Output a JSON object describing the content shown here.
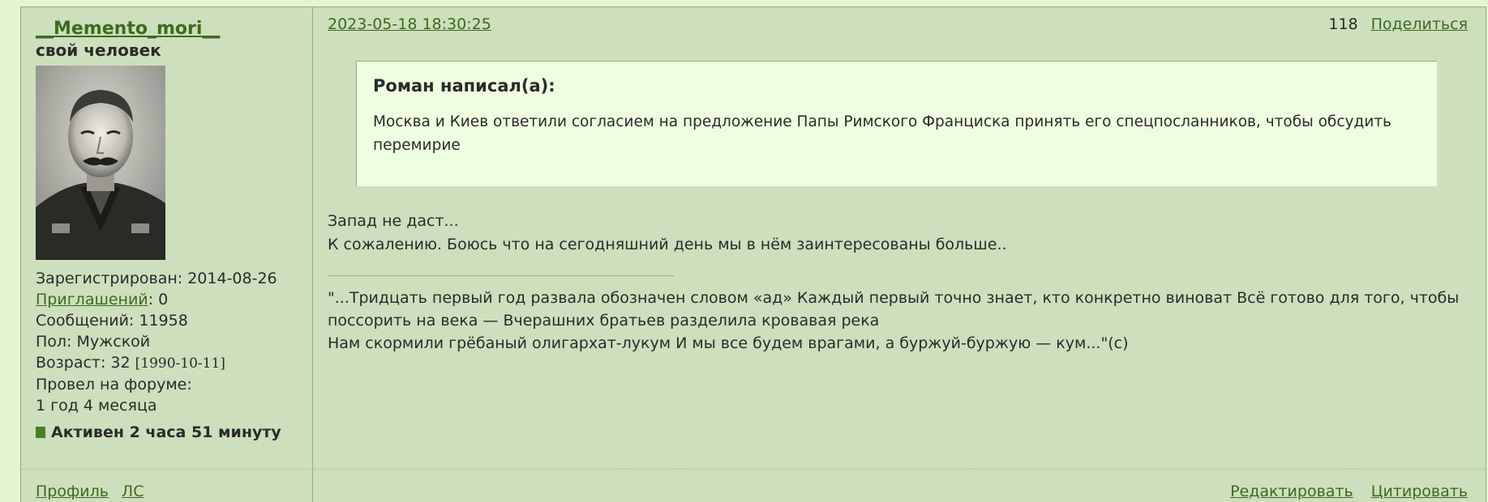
{
  "user": {
    "name": "__Memento_mori__",
    "title": "свой человек",
    "registered": "Зарегистрирован: 2014-08-26",
    "invites_label": "Приглашений",
    "invites_value": ": 0",
    "messages": "Сообщений: 11958",
    "gender": "Пол: Мужской",
    "age": "Возраст: 32 ",
    "birthdate": "[1990-10-11]",
    "forum_time_label": "Провел на форуме:",
    "forum_time_value": "1 год 4 месяца",
    "active": "Активен 2 часа 51 минуту"
  },
  "post": {
    "date": "2023-05-18 18:30:25",
    "number": "118",
    "share_label": "Поделиться",
    "quote": {
      "author": "Роман написал(а):",
      "text": "Москва и Киев ответили согласием на предложение Папы Римского Франциска принять его спецпосланников, чтобы обсудить перемирие"
    },
    "body": [
      "Запад не даст...",
      "К сожалению. Боюсь что на сегодняшний день мы в нём заинтересованы больше.."
    ],
    "signature": [
      "\"...Тридцать первый год развала обозначен словом «ад» Каждый первый точно знает, кто конкретно виноват Всё готово для того, чтобы поссорить на века — Вчерашних братьев разделила кровавая река",
      "Нам скормили грёбаный олигархат-лукум И мы все будем врагами, а буржуй-буржую — кум...\"(c)"
    ]
  },
  "footer": {
    "profile_label": "Профиль",
    "pm_label": "ЛС",
    "edit_label": "Редактировать",
    "quote_label": "Цитировать"
  }
}
